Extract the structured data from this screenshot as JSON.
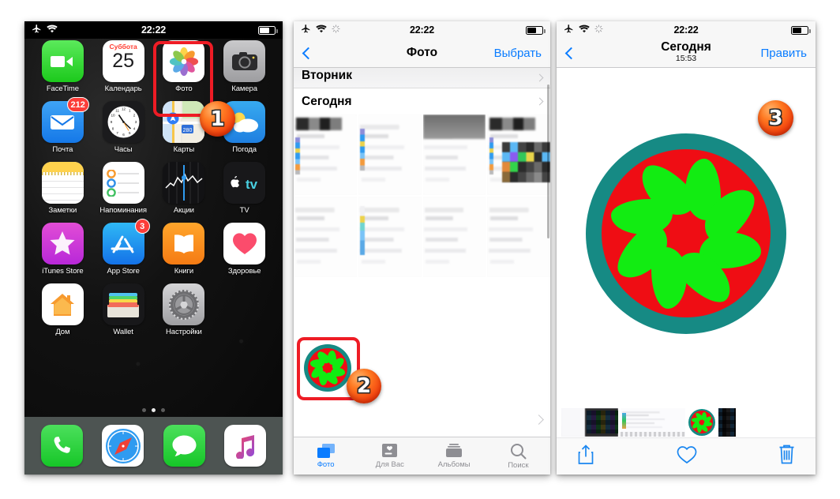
{
  "meta": {
    "accent_blue": "#0a7cff",
    "marker_orange": "#f2400d",
    "highlight_red": "#ee1c25",
    "citrus_rind": "#168a84",
    "citrus_flesh": "#ef0d14",
    "citrus_segment": "#12ec12"
  },
  "phone1": {
    "status": {
      "time": "22:22",
      "airplane_icon": "airplane-mode-icon",
      "wifi_icon": "wifi-icon",
      "battery_icon": "battery-icon"
    },
    "apps_rows": [
      [
        {
          "label": "FaceTime",
          "icon": "facetime-icon",
          "badge": ""
        },
        {
          "label": "Календарь",
          "icon": "calendar-icon",
          "badge": "",
          "cal_weekday": "Суббота",
          "cal_day": "25"
        },
        {
          "label": "Фото",
          "icon": "photos-icon",
          "badge": ""
        },
        {
          "label": "Камера",
          "icon": "camera-icon",
          "badge": ""
        }
      ],
      [
        {
          "label": "Почта",
          "icon": "mail-icon",
          "badge": "212"
        },
        {
          "label": "Часы",
          "icon": "clock-icon",
          "badge": ""
        },
        {
          "label": "Карты",
          "icon": "maps-icon",
          "badge": "",
          "route": "280"
        },
        {
          "label": "Погода",
          "icon": "weather-icon",
          "badge": ""
        }
      ],
      [
        {
          "label": "Заметки",
          "icon": "notes-icon",
          "badge": ""
        },
        {
          "label": "Напоминания",
          "icon": "reminders-icon",
          "badge": ""
        },
        {
          "label": "Акции",
          "icon": "stocks-icon",
          "badge": ""
        },
        {
          "label": "TV",
          "icon": "apple-tv-icon",
          "badge": ""
        }
      ],
      [
        {
          "label": "iTunes Store",
          "icon": "itunes-store-icon",
          "badge": ""
        },
        {
          "label": "App Store",
          "icon": "app-store-icon",
          "badge": "3"
        },
        {
          "label": "Книги",
          "icon": "books-icon",
          "badge": ""
        },
        {
          "label": "Здоровье",
          "icon": "health-icon",
          "badge": ""
        }
      ],
      [
        {
          "label": "Дом",
          "icon": "home-app-icon",
          "badge": ""
        },
        {
          "label": "Wallet",
          "icon": "wallet-icon",
          "badge": ""
        },
        {
          "label": "Настройки",
          "icon": "settings-icon",
          "badge": ""
        }
      ]
    ],
    "page_dots": {
      "count": 3,
      "active_index": 1
    },
    "dock": [
      {
        "label": "Телефон",
        "icon": "phone-icon"
      },
      {
        "label": "Safari",
        "icon": "safari-icon"
      },
      {
        "label": "Сообщения",
        "icon": "messages-icon"
      },
      {
        "label": "Музыка",
        "icon": "music-icon"
      }
    ],
    "marker": "1"
  },
  "phone2": {
    "status": {
      "time": "22:22",
      "airplane_icon": "airplane-mode-icon",
      "wifi_icon": "wifi-icon",
      "sync_icon": "sync-icon",
      "battery_icon": "battery-icon"
    },
    "nav": {
      "back_icon": "back-chevron-icon",
      "title": "Фото",
      "action": "Выбрать"
    },
    "sections": [
      {
        "title": "Вторник",
        "chevron": "disclosure-chevron-icon"
      },
      {
        "title": "Сегодня",
        "chevron": "disclosure-chevron-icon"
      }
    ],
    "tabs": [
      {
        "label": "Фото",
        "icon": "photos-tab-icon",
        "active": true
      },
      {
        "label": "Для Вас",
        "icon": "for-you-tab-icon",
        "active": false
      },
      {
        "label": "Альбомы",
        "icon": "albums-tab-icon",
        "active": false
      },
      {
        "label": "Поиск",
        "icon": "search-tab-icon",
        "active": false
      }
    ],
    "selected_photo_name": "citrus-slice-photo",
    "marker": "2"
  },
  "phone3": {
    "status": {
      "time": "22:22",
      "airplane_icon": "airplane-mode-icon",
      "wifi_icon": "wifi-icon",
      "sync_icon": "sync-icon",
      "battery_icon": "battery-icon"
    },
    "nav": {
      "back_icon": "back-chevron-icon",
      "title": "Сегодня",
      "subtitle": "15:53",
      "action": "Править"
    },
    "photo_name": "citrus-slice-photo",
    "filmstrip": [
      {
        "name": "screenshot-thumb-1"
      },
      {
        "name": "screenshot-thumb-2"
      },
      {
        "name": "citrus-slice-thumb",
        "selected": true
      },
      {
        "name": "screenshot-thumb-3"
      }
    ],
    "toolbar": [
      {
        "name": "share-button",
        "icon": "share-icon"
      },
      {
        "name": "favorite-button",
        "icon": "heart-icon"
      },
      {
        "name": "delete-button",
        "icon": "trash-icon"
      }
    ],
    "marker": "3"
  }
}
